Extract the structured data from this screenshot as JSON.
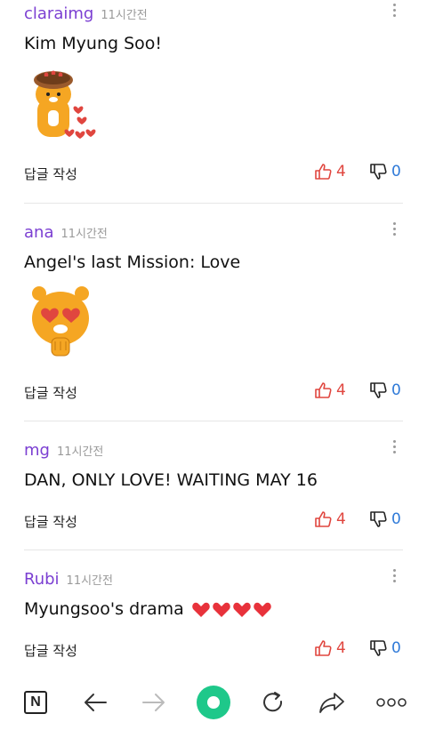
{
  "comments": [
    {
      "user": "claraimg",
      "time": "11시간전",
      "text": "Kim Myung Soo!",
      "sticker": "ryan-heart-basket",
      "reply_label": "답글 작성",
      "likes": "4",
      "dislikes": "0"
    },
    {
      "user": "ana",
      "time": "11시간전",
      "text": "Angel's last Mission: Love",
      "sticker": "ryan-heart-eyes",
      "reply_label": "답글 작성",
      "likes": "4",
      "dislikes": "0"
    },
    {
      "user": "mg",
      "time": "11시간전",
      "text": "DAN, ONLY LOVE! WAITING MAY 16",
      "reply_label": "답글 작성",
      "likes": "4",
      "dislikes": "0"
    },
    {
      "user": "Rubi",
      "time": "11시간전",
      "text": "Myungsoo's drama",
      "emoji": "❤❤❤❤",
      "reply_label": "답글 작성",
      "likes": "4",
      "dislikes": "0"
    }
  ],
  "bottom_bar": {
    "logo": "N",
    "icons": [
      "naver-home-icon",
      "back-arrow-icon",
      "forward-arrow-icon",
      "green-circle-icon",
      "refresh-icon",
      "share-icon",
      "more-icon"
    ]
  },
  "colors": {
    "username": "#7b3fd2",
    "like": "#e0463f",
    "dislike": "#2f7ad8",
    "accent": "#1ec88a"
  }
}
